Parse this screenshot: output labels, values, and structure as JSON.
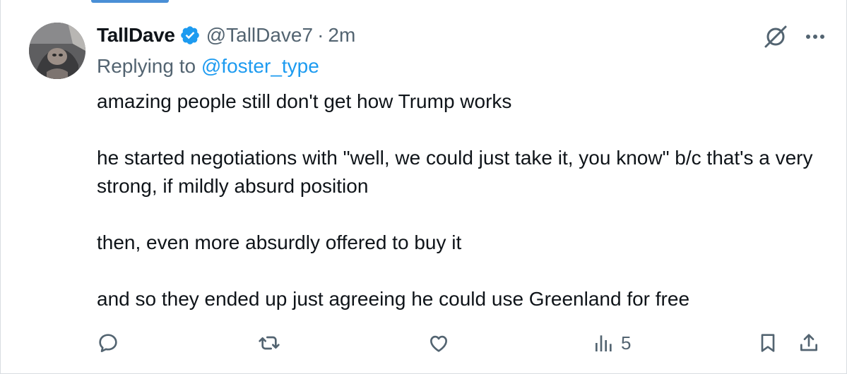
{
  "tweet": {
    "display_name": "TallDave",
    "handle": "@TallDave7",
    "separator": "·",
    "time": "2m",
    "replying_prefix": "Replying to",
    "replying_to": "@foster_type",
    "paragraphs": [
      "amazing people still don't get how Trump works",
      "he started negotiations with \"well, we could just take it, you know\" b/c that's a very strong, if mildly absurd position",
      "then, even more absurdly offered to buy it",
      "and so they ended up just agreeing he could use Greenland for free"
    ],
    "views_count": "5"
  },
  "icons": {
    "verified": "verified-badge-icon",
    "grok": "grok-icon",
    "more": "more-options-icon",
    "reply": "reply-icon",
    "retweet": "retweet-icon",
    "like": "like-icon",
    "views": "views-icon",
    "bookmark": "bookmark-icon",
    "share": "share-icon"
  },
  "colors": {
    "text_primary": "#0f1419",
    "text_secondary": "#536471",
    "link": "#1d9bf0",
    "verified": "#1d9bf0"
  }
}
